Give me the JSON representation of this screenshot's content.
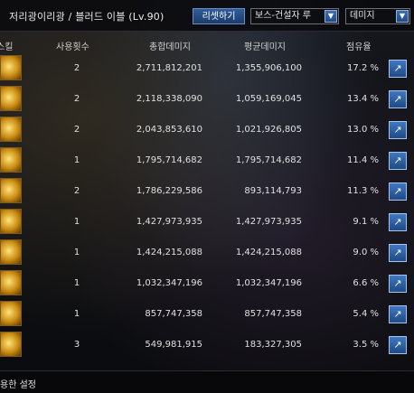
{
  "window": {
    "title": "저리광이리광 / 블러드 이블 (Lv.90)",
    "reset_label": "리셋하기",
    "target_select": "보스-건설자 루",
    "metric_select": "데미지"
  },
  "columns": {
    "skill": "스킬",
    "count": "사용횟수",
    "total": "총합데미지",
    "average": "평균데미지",
    "share": "점유율"
  },
  "rows": [
    {
      "count": "2",
      "total": "2,711,812,201",
      "average": "1,355,906,100",
      "share": "17.2 %"
    },
    {
      "count": "2",
      "total": "2,118,338,090",
      "average": "1,059,169,045",
      "share": "13.4 %"
    },
    {
      "count": "2",
      "total": "2,043,853,610",
      "average": "1,021,926,805",
      "share": "13.0 %"
    },
    {
      "count": "1",
      "total": "1,795,714,682",
      "average": "1,795,714,682",
      "share": "11.4 %"
    },
    {
      "count": "2",
      "total": "1,786,229,586",
      "average": "893,114,793",
      "share": "11.3 %"
    },
    {
      "count": "1",
      "total": "1,427,973,935",
      "average": "1,427,973,935",
      "share": "9.1 %"
    },
    {
      "count": "1",
      "total": "1,424,215,088",
      "average": "1,424,215,088",
      "share": "9.0 %"
    },
    {
      "count": "1",
      "total": "1,032,347,196",
      "average": "1,032,347,196",
      "share": "6.6 %"
    },
    {
      "count": "1",
      "total": "857,747,358",
      "average": "857,747,358",
      "share": "5.4 %"
    },
    {
      "count": "3",
      "total": "549,981,915",
      "average": "183,327,305",
      "share": "3.5 %"
    }
  ],
  "footer": {
    "label": "용한 설정"
  },
  "icons": {
    "share": "share-icon",
    "dropdown": "chevron-down-icon"
  }
}
